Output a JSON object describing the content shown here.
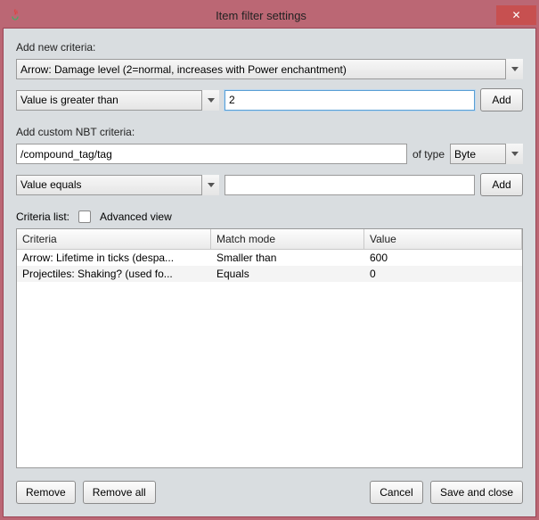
{
  "window": {
    "title": "Item filter settings",
    "close_icon": "✕"
  },
  "section1": {
    "label": "Add new criteria:",
    "criteria_select": "Arrow: Damage level (2=normal, increases with Power enchantment)",
    "match_select": "Value is greater than",
    "value_input": "2",
    "add_button": "Add"
  },
  "section2": {
    "label": "Add custom NBT criteria:",
    "path_input": "/compound_tag/tag",
    "of_type_label": "of type",
    "type_select": "Byte",
    "match_select": "Value equals",
    "value_input": "",
    "add_button": "Add"
  },
  "criteria_list": {
    "label": "Criteria list:",
    "advanced_checkbox_label": "Advanced view",
    "advanced_checked": false,
    "columns": [
      "Criteria",
      "Match mode",
      "Value"
    ],
    "rows": [
      {
        "criteria": "Arrow: Lifetime in ticks (despa...",
        "match": "Smaller than",
        "value": "600"
      },
      {
        "criteria": "Projectiles: Shaking? (used fo...",
        "match": "Equals",
        "value": "0"
      }
    ]
  },
  "footer": {
    "remove": "Remove",
    "remove_all": "Remove all",
    "cancel": "Cancel",
    "save": "Save and close"
  }
}
